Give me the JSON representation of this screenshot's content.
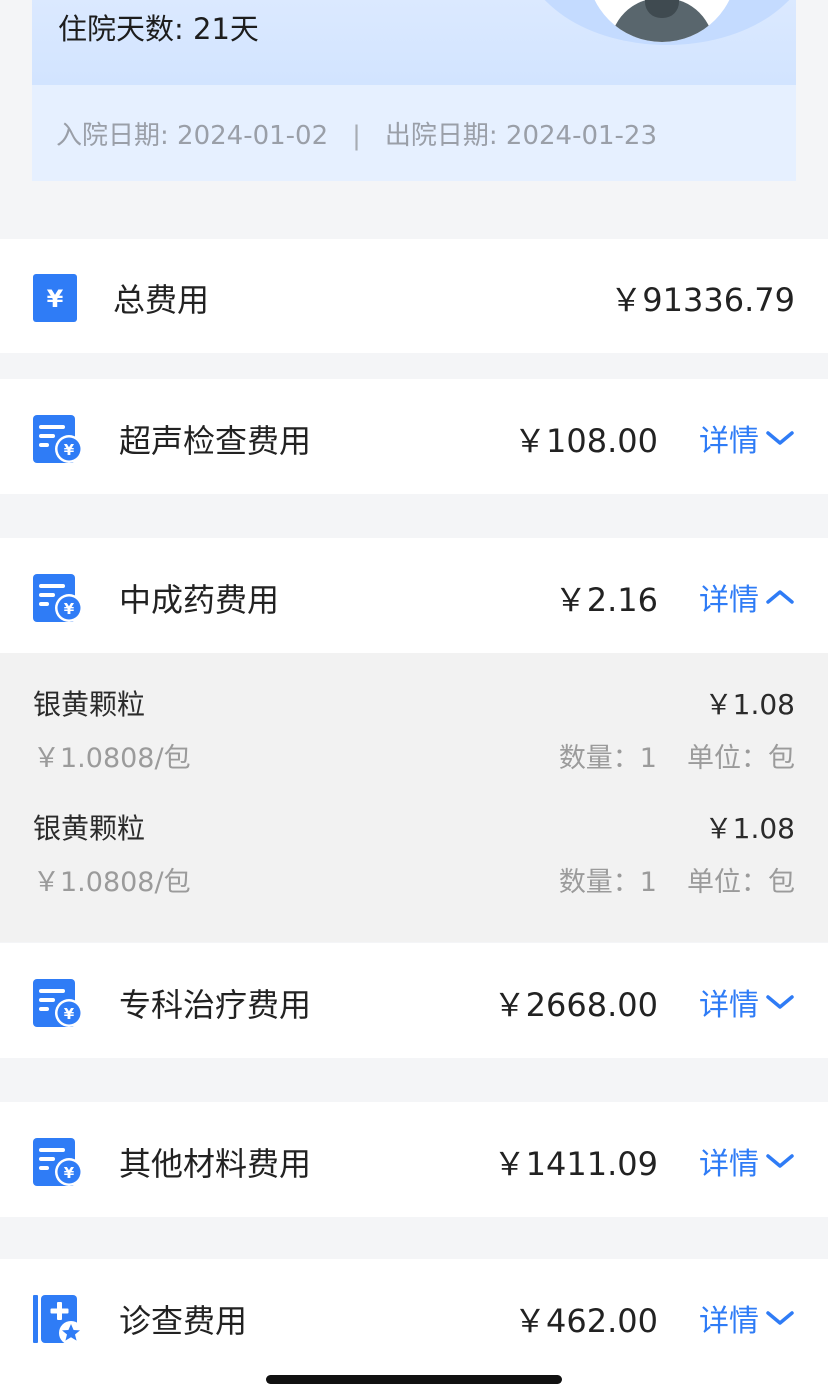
{
  "patient": {
    "stay_label": "住院天数: 21天",
    "admission_label": "入院日期: 2024-01-02",
    "separator": "|",
    "discharge_label": "出院日期: 2024-01-23"
  },
  "total": {
    "label": "总费用",
    "amount": "￥91336.79",
    "icon": "yen-icon"
  },
  "categories": [
    {
      "label": "超声检查费用",
      "amount": "￥108.00",
      "detail_label": "详情",
      "expanded": false,
      "icon": "bill-yen-icon"
    },
    {
      "label": "中成药费用",
      "amount": "￥2.16",
      "detail_label": "详情",
      "expanded": true,
      "icon": "bill-yen-icon"
    },
    {
      "label": "专科治疗费用",
      "amount": "￥2668.00",
      "detail_label": "详情",
      "expanded": false,
      "icon": "bill-yen-icon"
    },
    {
      "label": "其他材料费用",
      "amount": "￥1411.09",
      "detail_label": "详情",
      "expanded": false,
      "icon": "bill-yen-icon"
    },
    {
      "label": "诊查费用",
      "amount": "￥462.00",
      "detail_label": "详情",
      "expanded": false,
      "icon": "medical-kit-icon"
    }
  ],
  "medicine_items": [
    {
      "name": "银黄颗粒",
      "total": "￥1.08",
      "unit_price": "￥1.0808/包",
      "quantity": "数量：1",
      "unit": "单位：包"
    },
    {
      "name": "银黄颗粒",
      "total": "￥1.08",
      "unit_price": "￥1.0808/包",
      "quantity": "数量：1",
      "unit": "单位：包"
    }
  ],
  "colors": {
    "accent": "#2f7cf6",
    "icon_blue": "#2f7cf6",
    "header_bg": "#dbe9ff",
    "detail_bg": "#f2f2f2"
  }
}
